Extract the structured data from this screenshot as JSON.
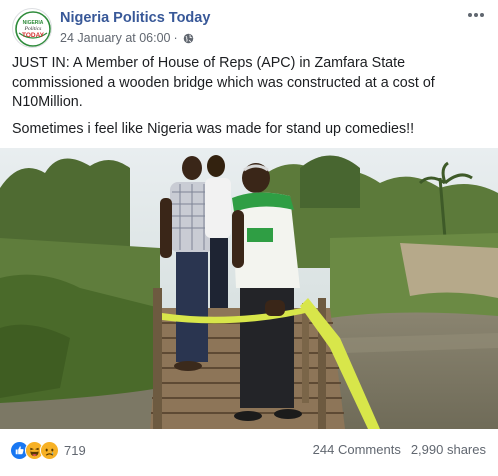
{
  "post": {
    "page_name": "Nigeria Politics Today",
    "timestamp": "24 January at 06:00",
    "separator": "·",
    "avatar_text_line1": "NIGERIA",
    "avatar_text_line2": "Politics",
    "avatar_text_line3": "TODAY",
    "privacy_icon": "globe-icon",
    "menu_icon": "more-horizontal-icon",
    "paragraphs": [
      "JUST IN: A Member of House of Reps (APC) in Zamfara State commissioned a wooden bridge which was constructed at a cost of N10Million.",
      "Sometimes i feel like Nigeria was made for stand up comedies!!"
    ]
  },
  "footer": {
    "reaction_icons": [
      "like-icon",
      "haha-icon",
      "sad-icon"
    ],
    "reaction_count": "719",
    "comments": "244 Comments",
    "shares": "2,990 shares"
  },
  "colors": {
    "page_name": "#385898",
    "meta": "#616770",
    "like": "#1877f2",
    "emoji": "#f7b125",
    "ribbon": "#d8e64a"
  }
}
